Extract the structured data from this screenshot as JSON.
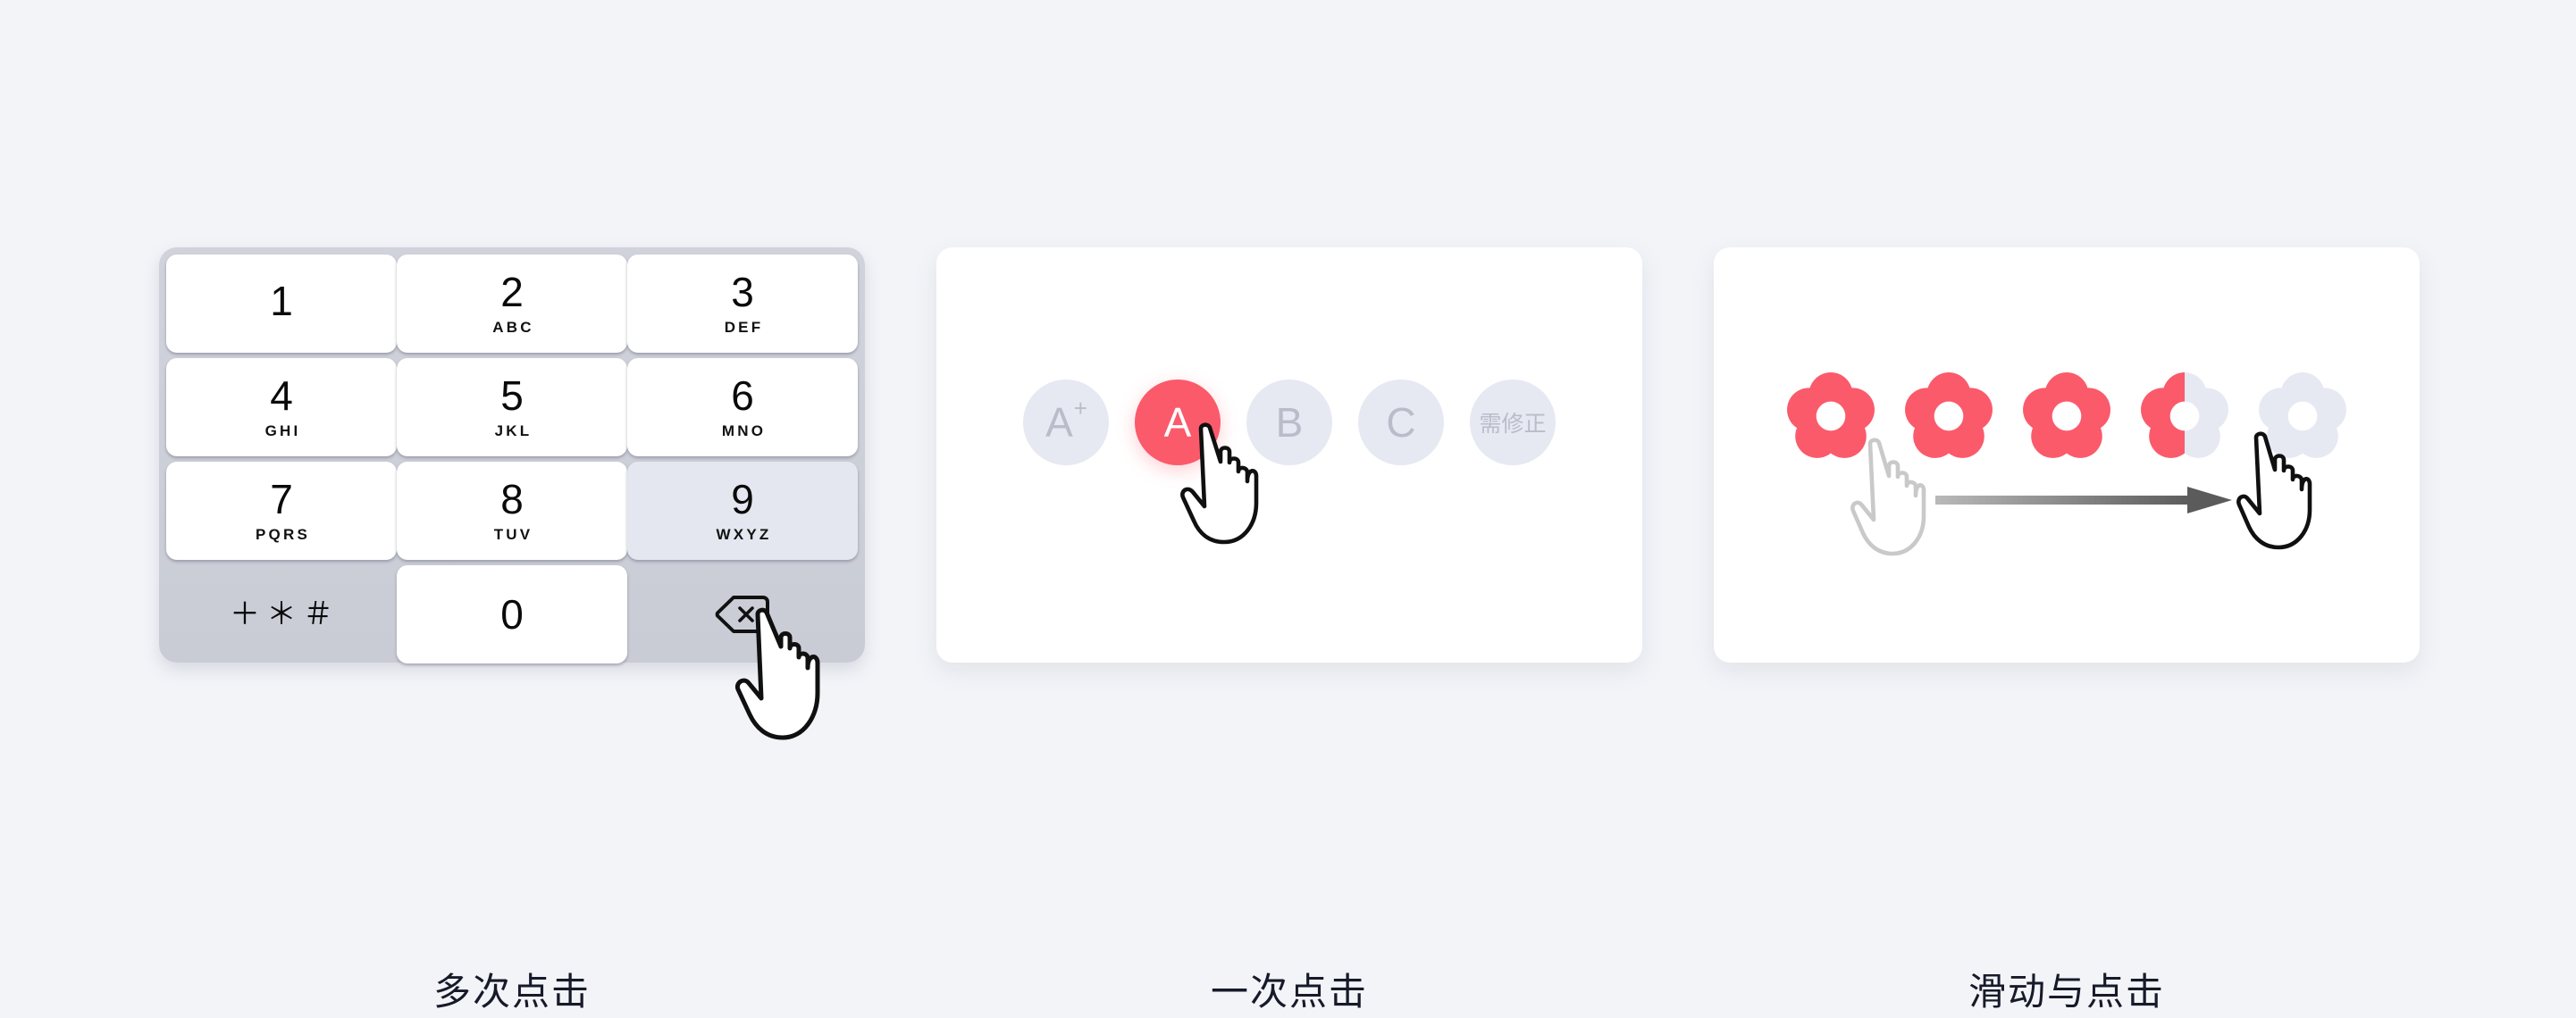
{
  "page": {
    "background_color": "#F3F4F8",
    "accent_color": "#FB5A6B",
    "muted_color": "#E6E9F2"
  },
  "panels": [
    {
      "id": "keypad",
      "caption": "多次点击",
      "type": "t9-keypad",
      "keys": [
        {
          "digit": "1",
          "letters": "",
          "state": "normal"
        },
        {
          "digit": "2",
          "letters": "ABC",
          "state": "normal"
        },
        {
          "digit": "3",
          "letters": "DEF",
          "state": "normal"
        },
        {
          "digit": "4",
          "letters": "GHI",
          "state": "normal"
        },
        {
          "digit": "5",
          "letters": "JKL",
          "state": "normal"
        },
        {
          "digit": "6",
          "letters": "MNO",
          "state": "normal"
        },
        {
          "digit": "7",
          "letters": "PQRS",
          "state": "normal"
        },
        {
          "digit": "8",
          "letters": "TUV",
          "state": "normal"
        },
        {
          "digit": "9",
          "letters": "WXYZ",
          "state": "pressed"
        },
        {
          "digit": "＋＊＃",
          "letters": "",
          "state": "flat"
        },
        {
          "digit": "0",
          "letters": "",
          "state": "normal"
        },
        {
          "digit": "",
          "letters": "",
          "state": "flat",
          "icon": "backspace-icon"
        }
      ],
      "cursor": {
        "icon": "pointing-hand-icon",
        "target": "key-9"
      }
    },
    {
      "id": "tap",
      "caption": "一次点击",
      "type": "letter-bubbles",
      "bubbles": [
        {
          "label": "A",
          "superscript": "+",
          "state": "inactive"
        },
        {
          "label": "A",
          "superscript": "",
          "state": "active"
        },
        {
          "label": "B",
          "superscript": "",
          "state": "inactive"
        },
        {
          "label": "C",
          "superscript": "",
          "state": "inactive"
        },
        {
          "label": "需修正",
          "superscript": "",
          "state": "inactive"
        }
      ],
      "cursor": {
        "icon": "pointing-hand-icon",
        "target": "bubble-a-active"
      }
    },
    {
      "id": "swipe",
      "caption": "滑动与点击",
      "type": "flower-rating",
      "flowers": [
        {
          "fill": "full"
        },
        {
          "fill": "full"
        },
        {
          "fill": "full"
        },
        {
          "fill": "half"
        },
        {
          "fill": "empty"
        }
      ],
      "rating_value": "3.5",
      "rating_max": "5",
      "arrow": {
        "icon": "swipe-arrow-icon",
        "direction": "right"
      },
      "cursors": [
        {
          "icon": "pointing-hand-icon",
          "position": "start",
          "style": "ghost"
        },
        {
          "icon": "pointing-hand-icon",
          "position": "end",
          "style": "solid"
        }
      ]
    }
  ]
}
